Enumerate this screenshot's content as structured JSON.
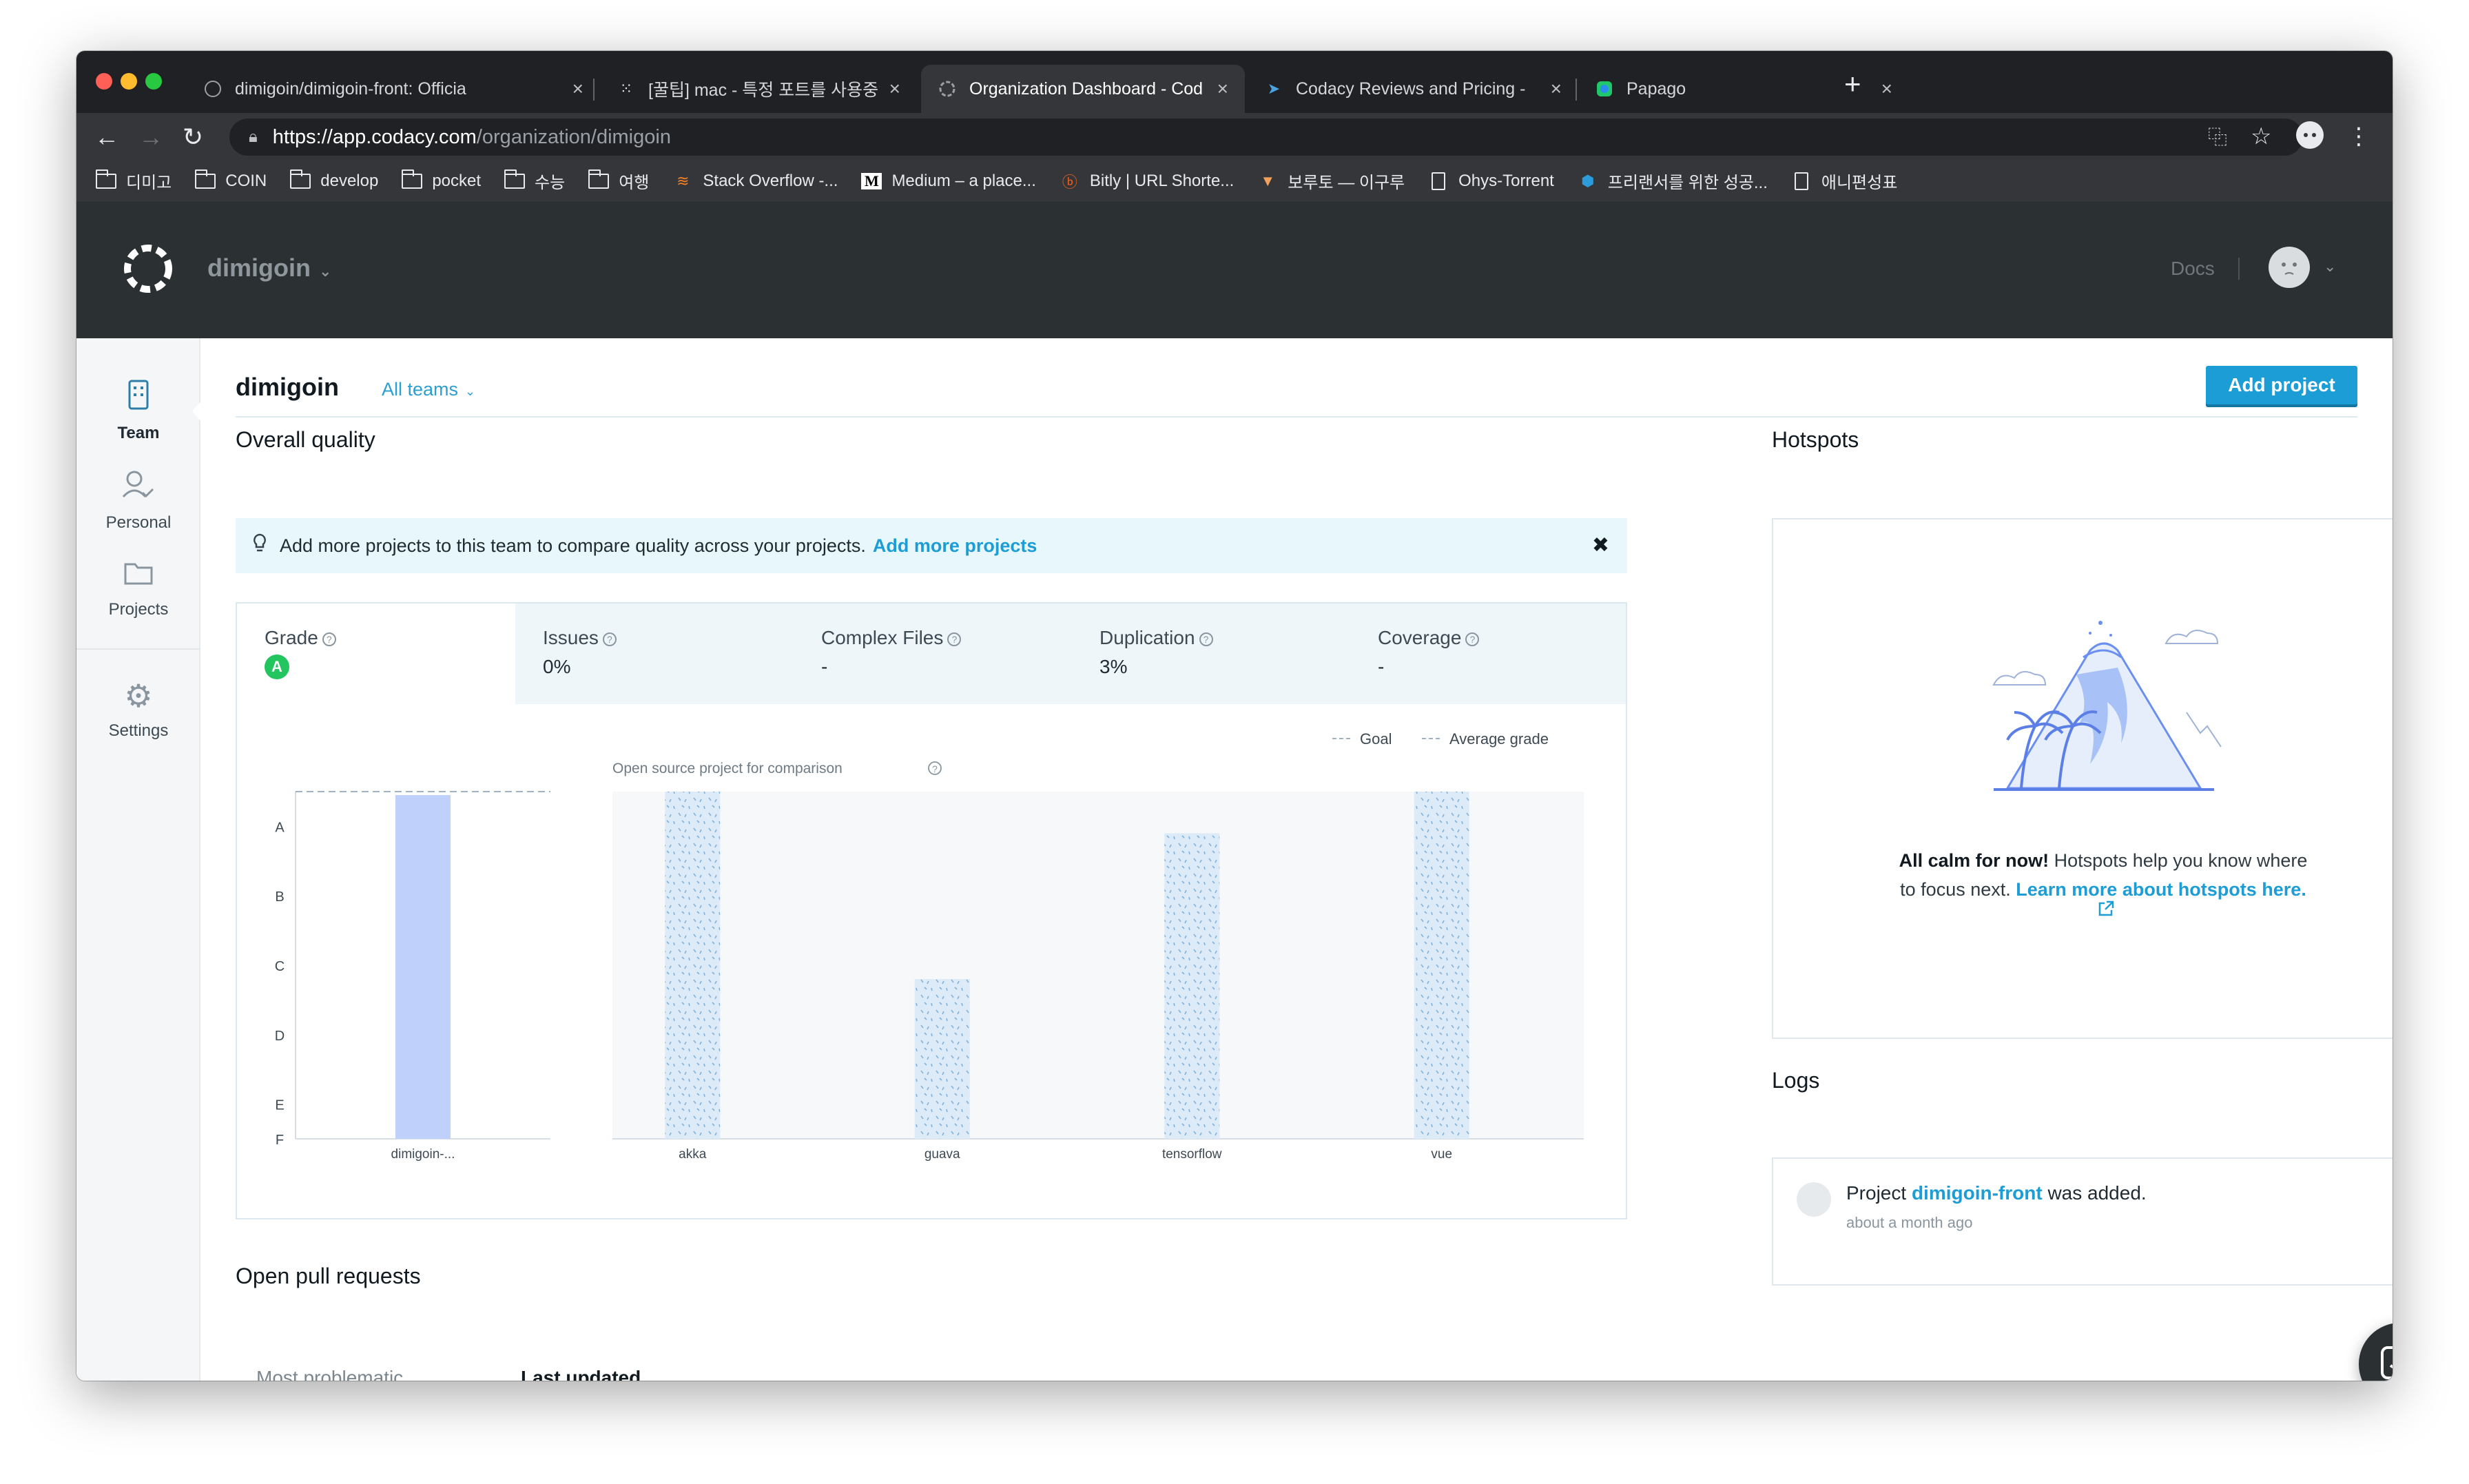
{
  "browser": {
    "tabs": [
      {
        "title": "dimigoin/dimigoin-front: Officia",
        "icon": "github-icon"
      },
      {
        "title": "[꿀팁] mac - 특정 포트를 사용중인",
        "icon": "tistory-icon"
      },
      {
        "title": "Organization Dashboard - Cod",
        "icon": "codacy-icon"
      },
      {
        "title": "Codacy Reviews and Pricing - ",
        "icon": "paper-plane-icon"
      },
      {
        "title": "Papago",
        "icon": "papago-icon"
      }
    ],
    "url_host": "https://app.codacy.com",
    "url_path": "/organization/dimigoin",
    "bookmarks": [
      {
        "label": "디미고",
        "icon": "folder-icon"
      },
      {
        "label": "COIN",
        "icon": "folder-icon"
      },
      {
        "label": "develop",
        "icon": "folder-icon"
      },
      {
        "label": "pocket",
        "icon": "folder-icon"
      },
      {
        "label": "수능",
        "icon": "folder-icon"
      },
      {
        "label": "여행",
        "icon": "folder-icon"
      },
      {
        "label": "Stack Overflow -...",
        "icon": "stackoverflow-icon"
      },
      {
        "label": "Medium – a place...",
        "icon": "medium-icon"
      },
      {
        "label": "Bitly | URL Shorte...",
        "icon": "bitly-icon"
      },
      {
        "label": "보루토 — 이구루",
        "icon": "site-icon"
      },
      {
        "label": "Ohys-Torrent",
        "icon": "document-icon"
      },
      {
        "label": "프리랜서를 위한 성공...",
        "icon": "hexagon-icon"
      },
      {
        "label": "애니편성표",
        "icon": "document-icon"
      }
    ]
  },
  "app": {
    "org": "dimigoin",
    "docs": "Docs",
    "sidebar": [
      {
        "label": "Team",
        "icon": "team-icon"
      },
      {
        "label": "Personal",
        "icon": "personal-icon"
      },
      {
        "label": "Projects",
        "icon": "folder-icon"
      },
      {
        "label": "Settings",
        "icon": "gear-icon"
      }
    ],
    "page_title": "dimigoin",
    "teams_filter": "All teams",
    "add_project": "Add project"
  },
  "overall": {
    "heading": "Overall quality",
    "banner_text": "Add more projects to this team to compare quality across your projects.",
    "banner_link": "Add more projects",
    "metrics": [
      {
        "label": "Grade",
        "value": "A"
      },
      {
        "label": "Issues",
        "value": "0%"
      },
      {
        "label": "Complex Files",
        "value": "-"
      },
      {
        "label": "Duplication",
        "value": "3%"
      },
      {
        "label": "Coverage",
        "value": "-"
      }
    ],
    "legend_goal": "Goal",
    "legend_avg": "Average grade",
    "comparison_label": "Open source project for comparison"
  },
  "chart_data": [
    {
      "type": "bar",
      "categories": [
        "dimigoin-..."
      ],
      "values": [
        4.95
      ],
      "y_tick_labels": [
        "A",
        "B",
        "C",
        "D",
        "E",
        "F"
      ],
      "ylim": [
        0,
        5
      ],
      "goal_line": 5,
      "color": "#bfd1fb"
    },
    {
      "type": "bar",
      "title": "Open source project for comparison",
      "categories": [
        "akka",
        "guava",
        "tensorflow",
        "vue"
      ],
      "values": [
        5.0,
        2.3,
        4.4,
        5.0
      ],
      "ylim": [
        0,
        5
      ],
      "color": "#d6eaf7"
    }
  ],
  "hotspots": {
    "heading": "Hotspots",
    "bold": "All calm for now!",
    "text": "Hotspots help you know where",
    "text2": "to focus next.",
    "link": "Learn more about hotspots here."
  },
  "logs": {
    "heading": "Logs",
    "prefix": "Project",
    "project": "dimigoin-front",
    "suffix": "was added.",
    "time": "about a month ago"
  },
  "pull_requests": {
    "heading": "Open pull requests",
    "tabs": [
      "Most problematic",
      "Last updated"
    ]
  }
}
